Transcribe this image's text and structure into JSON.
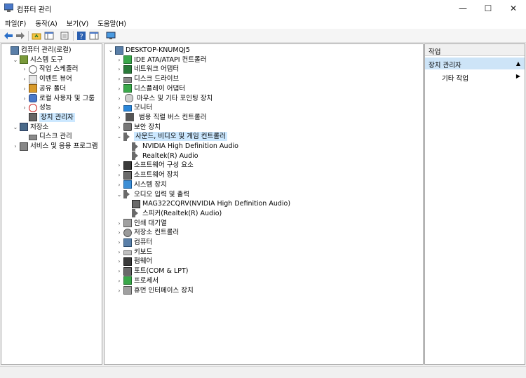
{
  "window": {
    "title": "컴퓨터 관리",
    "minimize": "—",
    "maximize": "☐",
    "close": "✕"
  },
  "menu": [
    "파일(F)",
    "동작(A)",
    "보기(V)",
    "도움말(H)"
  ],
  "left_tree": [
    {
      "label": "컴퓨터 관리(로컬)",
      "icon": "computer-management-icon",
      "depth": 0,
      "arrow": ""
    },
    {
      "label": "시스템 도구",
      "icon": "tools-icon",
      "depth": 1,
      "arrow": "v"
    },
    {
      "label": "작업 스케줄러",
      "icon": "clock-icon",
      "depth": 2,
      "arrow": ">"
    },
    {
      "label": "이벤트 뷰어",
      "icon": "event-viewer-icon",
      "depth": 2,
      "arrow": ">"
    },
    {
      "label": "공유 폴더",
      "icon": "shared-folder-icon",
      "depth": 2,
      "arrow": ">"
    },
    {
      "label": "로컬 사용자 및 그룹",
      "icon": "users-icon",
      "depth": 2,
      "arrow": ">"
    },
    {
      "label": "성능",
      "icon": "performance-icon",
      "depth": 2,
      "arrow": ">"
    },
    {
      "label": "장치 관리자",
      "icon": "device-manager-icon",
      "depth": 2,
      "arrow": "",
      "selected": true
    },
    {
      "label": "저장소",
      "icon": "storage-icon",
      "depth": 1,
      "arrow": "v"
    },
    {
      "label": "디스크 관리",
      "icon": "disk-management-icon",
      "depth": 2,
      "arrow": ""
    },
    {
      "label": "서비스 및 응용 프로그램",
      "icon": "services-icon",
      "depth": 1,
      "arrow": ">"
    }
  ],
  "device_tree": [
    {
      "label": "DESKTOP-KNUMQJ5",
      "icon": "computer-icon",
      "depth": 0,
      "arrow": "v"
    },
    {
      "label": "IDE ATA/ATAPI 컨트롤러",
      "icon": "ide-controller-icon",
      "depth": 1,
      "arrow": ">"
    },
    {
      "label": "네트워크 어댑터",
      "icon": "network-adapter-icon",
      "depth": 1,
      "arrow": ">"
    },
    {
      "label": "디스크 드라이브",
      "icon": "disk-drive-icon",
      "depth": 1,
      "arrow": ">"
    },
    {
      "label": "디스플레이 어댑터",
      "icon": "display-adapter-icon",
      "depth": 1,
      "arrow": ">"
    },
    {
      "label": "마우스 및 기타 포인팅 장치",
      "icon": "mouse-icon",
      "depth": 1,
      "arrow": ">"
    },
    {
      "label": "모니터",
      "icon": "monitor-icon",
      "depth": 1,
      "arrow": ">"
    },
    {
      "label": "범용 직렬 버스 컨트롤러",
      "icon": "usb-icon",
      "depth": 1,
      "arrow": ">"
    },
    {
      "label": "보안 장치",
      "icon": "security-device-icon",
      "depth": 1,
      "arrow": ">"
    },
    {
      "label": "사운드, 비디오 및 게임 컨트롤러",
      "icon": "sound-icon",
      "depth": 1,
      "arrow": "v",
      "highlight": true
    },
    {
      "label": "NVIDIA High Definition Audio",
      "icon": "speaker-icon",
      "depth": 2,
      "arrow": ""
    },
    {
      "label": "Realtek(R) Audio",
      "icon": "speaker-icon",
      "depth": 2,
      "arrow": ""
    },
    {
      "label": "소프트웨어 구성 요소",
      "icon": "software-component-icon",
      "depth": 1,
      "arrow": ">"
    },
    {
      "label": "소프트웨어 장치",
      "icon": "software-device-icon",
      "depth": 1,
      "arrow": ">"
    },
    {
      "label": "시스템 장치",
      "icon": "system-device-icon",
      "depth": 1,
      "arrow": ">"
    },
    {
      "label": "오디오 입력 및 출력",
      "icon": "audio-io-icon",
      "depth": 1,
      "arrow": "v"
    },
    {
      "label": "MAG322CQRV(NVIDIA High Definition Audio)",
      "icon": "audio-monitor-icon",
      "depth": 2,
      "arrow": ""
    },
    {
      "label": "스피커(Realtek(R) Audio)",
      "icon": "speaker-icon",
      "depth": 2,
      "arrow": ""
    },
    {
      "label": "인쇄 대기열",
      "icon": "print-queue-icon",
      "depth": 1,
      "arrow": ">"
    },
    {
      "label": "저장소 컨트롤러",
      "icon": "storage-controller-icon",
      "depth": 1,
      "arrow": ">"
    },
    {
      "label": "컴퓨터",
      "icon": "computer-icon",
      "depth": 1,
      "arrow": ">"
    },
    {
      "label": "키보드",
      "icon": "keyboard-icon",
      "depth": 1,
      "arrow": ">"
    },
    {
      "label": "펌웨어",
      "icon": "firmware-icon",
      "depth": 1,
      "arrow": ">"
    },
    {
      "label": "포트(COM & LPT)",
      "icon": "port-icon",
      "depth": 1,
      "arrow": ">"
    },
    {
      "label": "프로세서",
      "icon": "processor-icon",
      "depth": 1,
      "arrow": ">"
    },
    {
      "label": "휴먼 인터페이스 장치",
      "icon": "hid-icon",
      "depth": 1,
      "arrow": ">"
    }
  ],
  "actions": {
    "header": "작업",
    "section": "장치 관리자",
    "item": "기타 작업"
  },
  "colors": {
    "selection": "#cce8ff",
    "action_section": "#cde4f7"
  }
}
